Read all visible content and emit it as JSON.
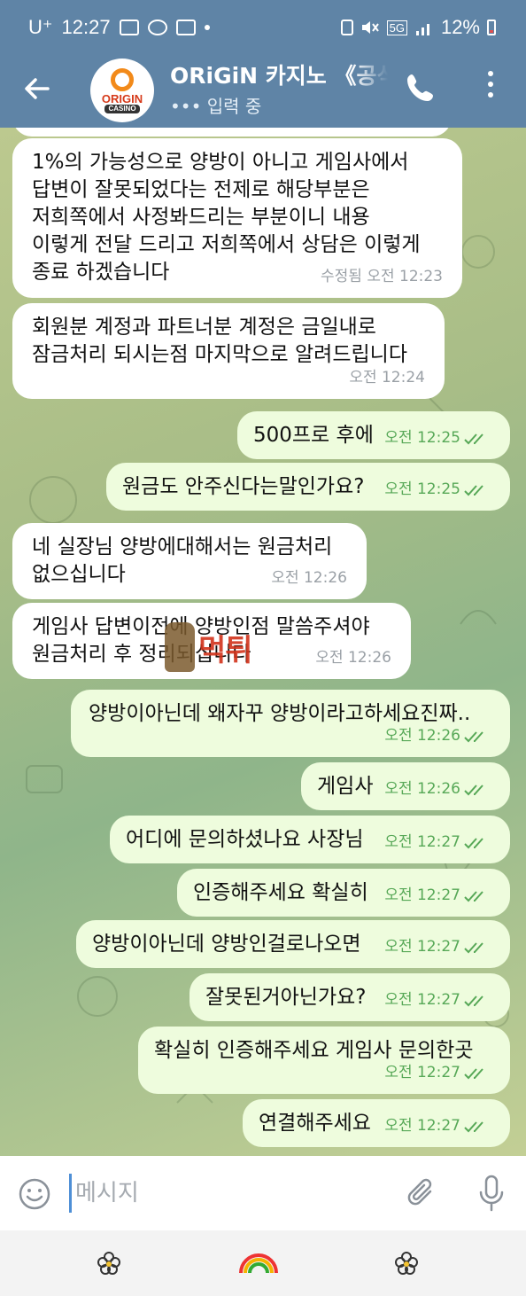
{
  "status_bar": {
    "carrier": "U⁺",
    "time": "12:27",
    "network": "5G",
    "battery": "12%"
  },
  "header": {
    "avatar_brand": "ORIGIN",
    "avatar_sub": "CASINO",
    "title": "ORiGiN 카지노 《공식",
    "status": "••• 입력 중"
  },
  "messages": [
    {
      "side": "in",
      "text": "1%의 가능성으로 양방이 아니고 게임사에서\n답변이 잘못되었다는 전제로 해당부분은\n저희쪽에서 사정봐드리는 부분이니 내용\n이렇게 전달 드리고 저희쪽에서 상담은 이렇게\n종료 하겠습니다",
      "time": "수정됨 오전 12:23"
    },
    {
      "side": "in",
      "text": "회원분 계정과 파트너분 계정은 금일내로\n잠금처리 되시는점 마지막으로 알려드립니다",
      "time": "오전 12:24"
    },
    {
      "side": "out",
      "text": "500프로 후에",
      "time": "오전 12:25"
    },
    {
      "side": "out",
      "text": "원금도 안주신다는말인가요?",
      "time": "오전 12:25"
    },
    {
      "side": "in",
      "text": "네 실장님 양방에대해서는 원금처리\n없으십니다",
      "time": "오전 12:26"
    },
    {
      "side": "in",
      "text": "게임사 답변이전에 양방인점 말씀주셔야\n원금처리 후 정리되십니다",
      "time": "오전 12:26"
    },
    {
      "side": "out",
      "text": "양방이아닌데 왜자꾸 양방이라고하세요진짜..",
      "time": "오전 12:26"
    },
    {
      "side": "out",
      "text": "게임사",
      "time": "오전 12:26"
    },
    {
      "side": "out",
      "text": "어디에 문의하셨나요 사장님",
      "time": "오전 12:27"
    },
    {
      "side": "out",
      "text": "인증해주세요 확실히",
      "time": "오전 12:27"
    },
    {
      "side": "out",
      "text": "양방이아닌데 양방인걸로나오면",
      "time": "오전 12:27"
    },
    {
      "side": "out",
      "text": "잘못된거아닌가요?",
      "time": "오전 12:27"
    },
    {
      "side": "out",
      "text": "확실히 인증해주세요 게임사 문의한곳",
      "time": "오전 12:27"
    },
    {
      "side": "out",
      "text": "연결해주세요",
      "time": "오전 12:27"
    }
  ],
  "watermark": {
    "text": "먹튀"
  },
  "input": {
    "placeholder": "메시지"
  },
  "icons": {
    "back": "arrow-left-icon",
    "call": "phone-icon",
    "more": "more-vertical-icon",
    "emoji": "emoji-icon",
    "attach": "paperclip-icon",
    "mic": "microphone-icon",
    "read": "double-check-icon"
  },
  "colors": {
    "header": "#5f84a6",
    "incoming": "#ffffff",
    "outgoing": "#eefcdd",
    "outgoing_meta": "#57a857"
  }
}
